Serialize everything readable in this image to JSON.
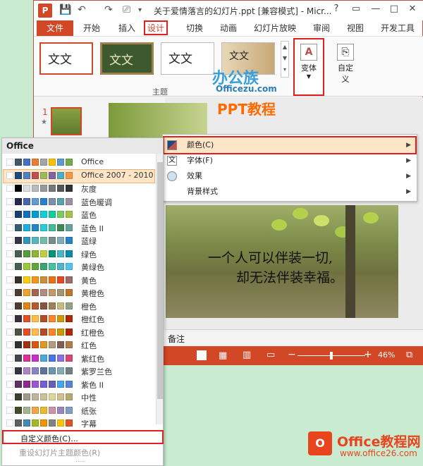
{
  "window": {
    "title": "关于爱情落言的幻灯片.ppt [兼容模式] - Micr...",
    "help": "?",
    "restore": "▭",
    "minimize": "—",
    "maximize": "□",
    "close": "✕",
    "app_icon": "P"
  },
  "tabs": [
    "文件",
    "开始",
    "插入",
    "设计",
    "切换",
    "动画",
    "幻灯片放映",
    "审阅",
    "视图",
    "开发工具"
  ],
  "ribbon": {
    "themes": [
      "文文",
      "文文",
      "文文",
      "文文"
    ],
    "group_label": "主题",
    "variant_label": "变体",
    "custom_label": "自定义"
  },
  "watermark": {
    "line1": "办公族",
    "line2": "Officezu.com",
    "line3": "PPT教程"
  },
  "slide_panel": {
    "number": "1",
    "star": "★"
  },
  "submenu": {
    "items": [
      "颜色(C)",
      "字体(F)",
      "效果",
      "背景样式"
    ]
  },
  "slide": {
    "text1": "一个人可以伴装一切,",
    "text2": "却无法伴装幸福。"
  },
  "notes_label": "备注",
  "status": {
    "label": "注",
    "zoom_minus": "−",
    "zoom_plus": "+",
    "zoom": "46%"
  },
  "colors_menu": {
    "header": "Office",
    "rows": [
      {
        "name": "Office",
        "colors": [
          "#ffffff",
          "#44546a",
          "#4472c4",
          "#ed7d31",
          "#a5a5a5",
          "#ffc000",
          "#5b9bd5",
          "#70ad47"
        ]
      },
      {
        "name": "Office 2007 - 2010",
        "colors": [
          "#ffffff",
          "#1f497d",
          "#4f81bd",
          "#c0504d",
          "#9bbb59",
          "#8064a2",
          "#4bacc6",
          "#f79646"
        ]
      },
      {
        "name": "灰度",
        "colors": [
          "#ffffff",
          "#000000",
          "#dddddd",
          "#bbbbbb",
          "#999999",
          "#777777",
          "#555555",
          "#333333"
        ]
      },
      {
        "name": "蓝色暖调",
        "colors": [
          "#ffffff",
          "#242852",
          "#4a66ac",
          "#629dd1",
          "#297fd5",
          "#7f8fa9",
          "#5aa2ae",
          "#9d90a0"
        ]
      },
      {
        "name": "蓝色",
        "colors": [
          "#ffffff",
          "#17406d",
          "#0f6fc6",
          "#009dd9",
          "#0bd0d9",
          "#10cf9b",
          "#7cca62",
          "#a5c249"
        ]
      },
      {
        "name": "蓝色 II",
        "colors": [
          "#ffffff",
          "#335b74",
          "#1cade4",
          "#2683c6",
          "#27ced7",
          "#42ba97",
          "#3e8853",
          "#62a39f"
        ]
      },
      {
        "name": "蓝绿",
        "colors": [
          "#ffffff",
          "#373545",
          "#3494ba",
          "#58b6c0",
          "#75bda7",
          "#7a8c8e",
          "#84acb6",
          "#2683c6"
        ]
      },
      {
        "name": "绿色",
        "colors": [
          "#ffffff",
          "#455f51",
          "#549e39",
          "#8ab833",
          "#c0cf3a",
          "#029676",
          "#4ab5c4",
          "#0989b1"
        ]
      },
      {
        "name": "黄绿色",
        "colors": [
          "#ffffff",
          "#455f51",
          "#99cb38",
          "#63a537",
          "#37a76f",
          "#44c1a3",
          "#4eb3cf",
          "#51c3f9"
        ]
      },
      {
        "name": "黄色",
        "colors": [
          "#ffffff",
          "#39302a",
          "#ffca08",
          "#f8931d",
          "#ce8d3e",
          "#ec7016",
          "#e64823",
          "#9c6a6a"
        ]
      },
      {
        "name": "黄橙色",
        "colors": [
          "#ffffff",
          "#4e3b30",
          "#f0a22e",
          "#a5644e",
          "#b58b80",
          "#c3986d",
          "#a19574",
          "#c17529"
        ]
      },
      {
        "name": "橙色",
        "colors": [
          "#ffffff",
          "#4e3b30",
          "#e48312",
          "#bd582c",
          "#865640",
          "#9b8357",
          "#c2bc80",
          "#94a088"
        ]
      },
      {
        "name": "橙红色",
        "colors": [
          "#ffffff",
          "#3c2c3e",
          "#e84c22",
          "#ffbd47",
          "#b64926",
          "#ff8427",
          "#cc9900",
          "#b22600"
        ]
      },
      {
        "name": "红橙色",
        "colors": [
          "#ffffff",
          "#505046",
          "#e84c22",
          "#ffbd47",
          "#b64926",
          "#ff8427",
          "#cc9900",
          "#b22600"
        ]
      },
      {
        "name": "红色",
        "colors": [
          "#ffffff",
          "#323232",
          "#a5300f",
          "#d55816",
          "#e19825",
          "#b19c7d",
          "#7f5f52",
          "#b27d49"
        ]
      },
      {
        "name": "紫红色",
        "colors": [
          "#ffffff",
          "#454551",
          "#e32d91",
          "#c830cc",
          "#4ea6dc",
          "#4775e7",
          "#8971e1",
          "#d54773"
        ]
      },
      {
        "name": "紫罗兰色",
        "colors": [
          "#ffffff",
          "#373545",
          "#ad84c6",
          "#8784c7",
          "#5d739a",
          "#6997af",
          "#84acb6",
          "#6f8183"
        ]
      },
      {
        "name": "紫色 II",
        "colors": [
          "#ffffff",
          "#632e62",
          "#92278f",
          "#9b57d3",
          "#755dd9",
          "#665eb8",
          "#45a5ed",
          "#5982db"
        ]
      },
      {
        "name": "中性",
        "colors": [
          "#ffffff",
          "#3e3d2d",
          "#9f9b8b",
          "#c0b49e",
          "#ccbf9c",
          "#e0d39c",
          "#d1bf8d",
          "#b8a96e"
        ]
      },
      {
        "name": "纸张",
        "colors": [
          "#ffffff",
          "#444d26",
          "#a5b592",
          "#f3a447",
          "#e7bc29",
          "#d092a7",
          "#9c85c0",
          "#809ec2"
        ]
      },
      {
        "name": "字幕",
        "colors": [
          "#ffffff",
          "#5e5e5e",
          "#418ab3",
          "#a6b727",
          "#f69200",
          "#838383",
          "#fec306",
          "#df5327"
        ]
      }
    ],
    "custom": "自定义颜色(C)...",
    "reset": "重设幻灯片主题颜色(R)",
    "more": "....."
  },
  "logo": {
    "icon": "O",
    "text1": "Office教程网",
    "text2": "www.office26.com"
  }
}
